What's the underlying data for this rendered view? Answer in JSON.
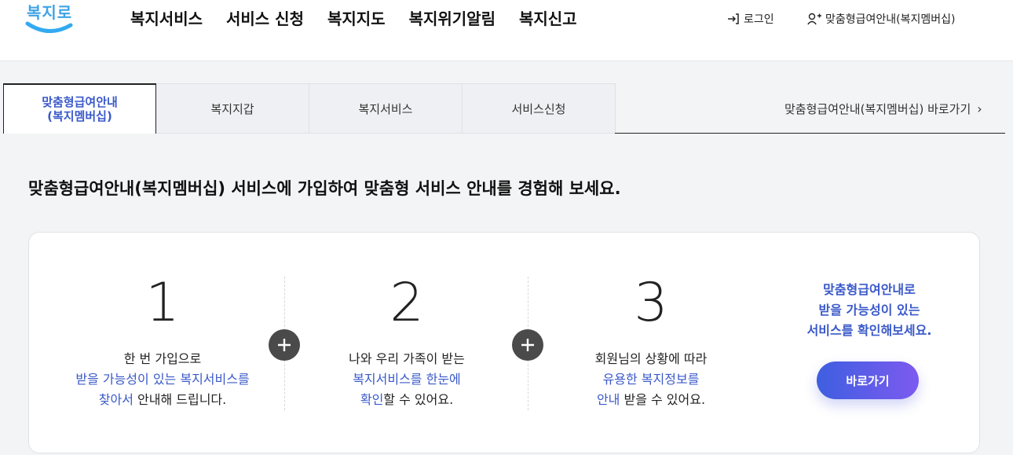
{
  "header": {
    "logo_text": "복지로",
    "nav": [
      "복지서비스",
      "서비스 신청",
      "복지지도",
      "복지위기알림",
      "복지신고"
    ],
    "login": "로그인",
    "membership": "맞춤형급여안내(복지멤버십)"
  },
  "tabs": {
    "items": [
      {
        "line1": "맞춤형급여안내",
        "line2": "(복지멤버십)"
      },
      {
        "label": "복지지갑"
      },
      {
        "label": "복지서비스"
      },
      {
        "label": "서비스신청"
      }
    ],
    "shortcut": "맞춤형급여안내(복지멤버십) 바로가기"
  },
  "intro": "맞춤형급여안내(복지멤버십) 서비스에 가입하여 맞춤형 서비스 안내를 경험해 보세요.",
  "steps": [
    {
      "num": "1",
      "l1": "한 번 가입으로",
      "l2": "받을 가능성이 있는 복지서비스를",
      "l3a": "찾아서",
      "l3b": " 안내해 드립니다."
    },
    {
      "num": "2",
      "l1": "나와 우리 가족이 받는",
      "l2": "복지서비스를 한눈에",
      "l3a": "확인",
      "l3b": "할 수 있어요."
    },
    {
      "num": "3",
      "l1": "회원님의 상황에 따라",
      "l2": "유용한 복지정보를",
      "l3a": "안내",
      "l3b": " 받을 수 있어요."
    }
  ],
  "cta": {
    "l1": "맞춤형급여안내로",
    "l2": "받을 가능성이 있는",
    "l3": "서비스를 확인해보세요.",
    "button": "바로가기"
  },
  "colors": {
    "accent": "#3a59c9",
    "button_start": "#3e5fe0",
    "button_end": "#7d5af0"
  }
}
